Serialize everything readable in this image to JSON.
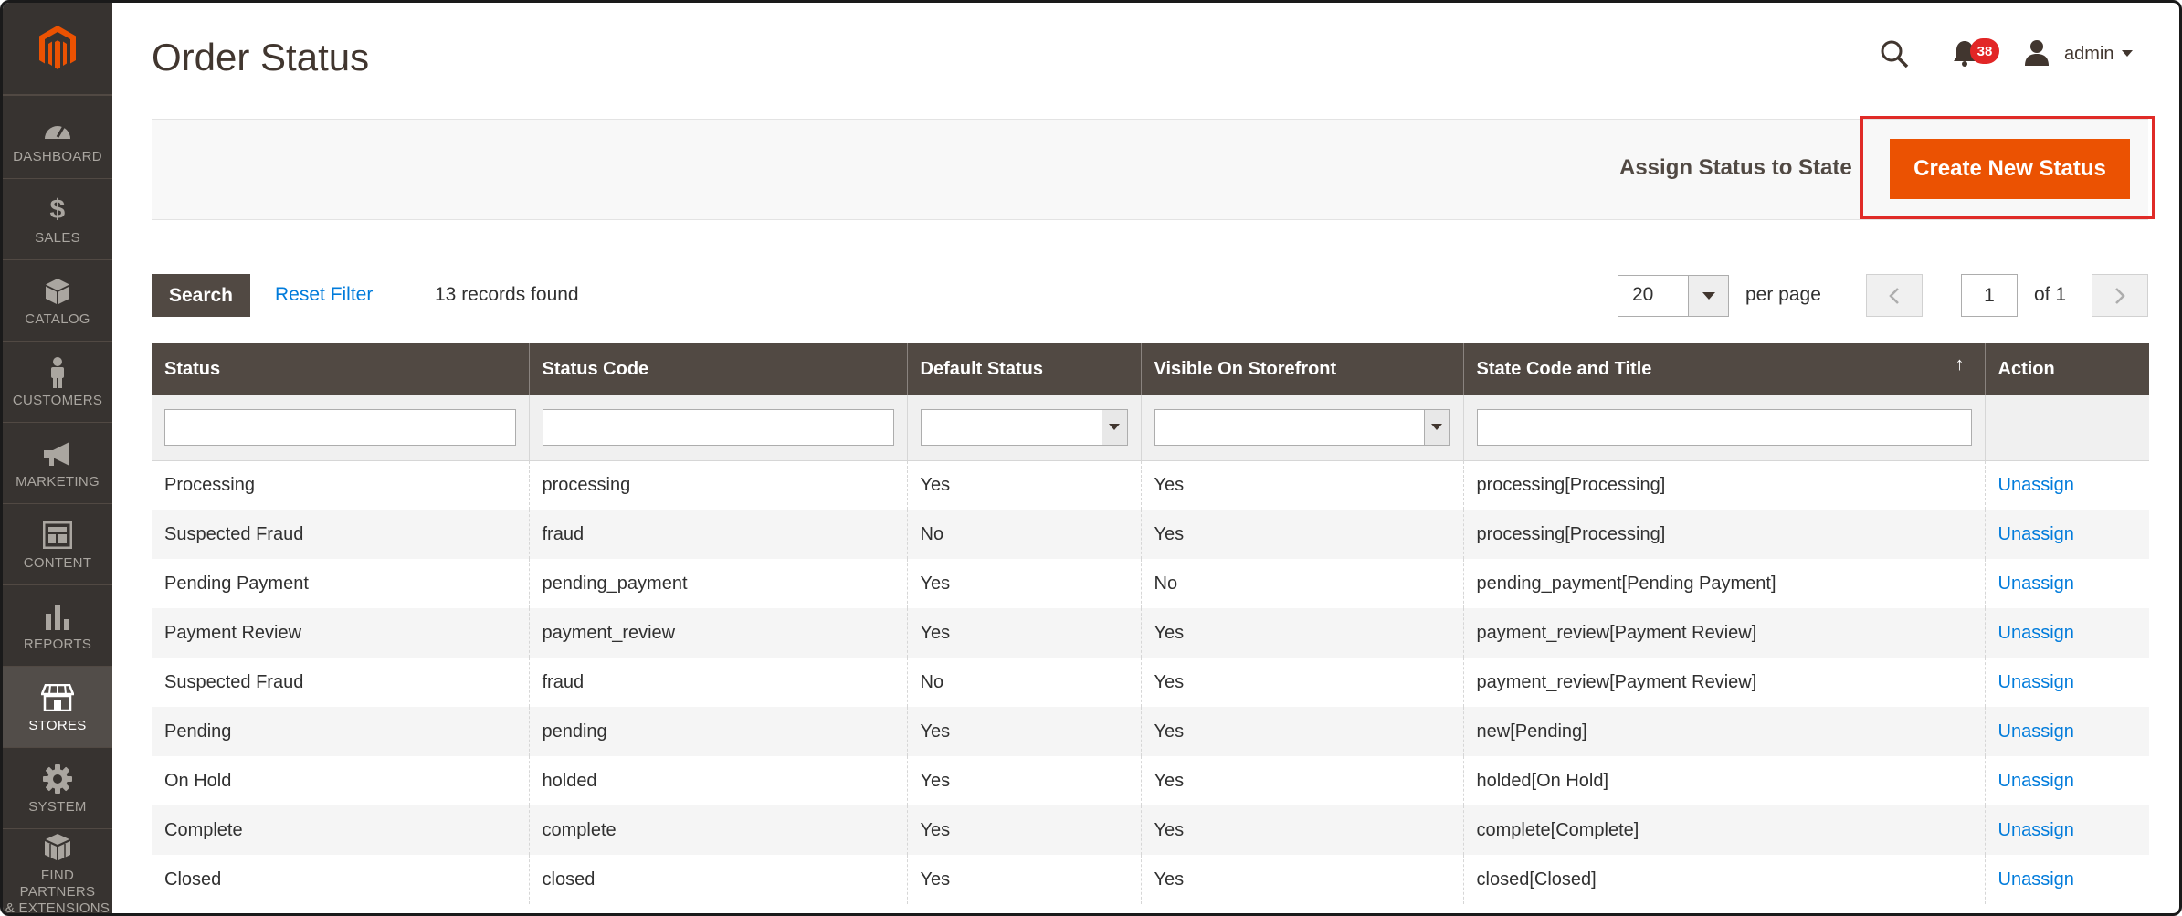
{
  "sidebar": {
    "items": [
      {
        "label": "DASHBOARD",
        "icon": "dashboard-icon"
      },
      {
        "label": "SALES",
        "icon": "dollar-icon"
      },
      {
        "label": "CATALOG",
        "icon": "cube-icon"
      },
      {
        "label": "CUSTOMERS",
        "icon": "person-icon"
      },
      {
        "label": "MARKETING",
        "icon": "megaphone-icon"
      },
      {
        "label": "CONTENT",
        "icon": "layout-icon"
      },
      {
        "label": "REPORTS",
        "icon": "bar-chart-icon"
      },
      {
        "label": "STORES",
        "icon": "store-icon"
      },
      {
        "label": "SYSTEM",
        "icon": "gear-icon"
      },
      {
        "label_line1": "FIND PARTNERS",
        "label_line2": "& EXTENSIONS",
        "icon": "boxes-icon"
      }
    ],
    "active": "STORES"
  },
  "header": {
    "title": "Order Status",
    "notifications_count": "38",
    "user": "admin"
  },
  "actions": {
    "assign_label": "Assign Status to State",
    "create_label": "Create New Status"
  },
  "grid_toolbar": {
    "search_label": "Search",
    "reset_label": "Reset Filter",
    "records_text": "13 records found",
    "per_page_value": "20",
    "per_page_label": "per page",
    "current_page": "1",
    "page_of": "of 1"
  },
  "table": {
    "columns": [
      "Status",
      "Status Code",
      "Default Status",
      "Visible On Storefront",
      "State Code and Title",
      "Action"
    ],
    "sorted_column_arrow": "↑",
    "rows": [
      [
        "Processing",
        "processing",
        "Yes",
        "Yes",
        "processing[Processing]",
        "Unassign"
      ],
      [
        "Suspected Fraud",
        "fraud",
        "No",
        "Yes",
        "processing[Processing]",
        "Unassign"
      ],
      [
        "Pending Payment",
        "pending_payment",
        "Yes",
        "No",
        "pending_payment[Pending Payment]",
        "Unassign"
      ],
      [
        "Payment Review",
        "payment_review",
        "Yes",
        "Yes",
        "payment_review[Payment Review]",
        "Unassign"
      ],
      [
        "Suspected Fraud",
        "fraud",
        "No",
        "Yes",
        "payment_review[Payment Review]",
        "Unassign"
      ],
      [
        "Pending",
        "pending",
        "Yes",
        "Yes",
        "new[Pending]",
        "Unassign"
      ],
      [
        "On Hold",
        "holded",
        "Yes",
        "Yes",
        "holded[On Hold]",
        "Unassign"
      ],
      [
        "Complete",
        "complete",
        "Yes",
        "Yes",
        "complete[Complete]",
        "Unassign"
      ],
      [
        "Closed",
        "closed",
        "Yes",
        "Yes",
        "closed[Closed]",
        "Unassign"
      ]
    ]
  },
  "colors": {
    "sidebar_bg": "#373330",
    "accent_orange": "#eb5202",
    "header_row": "#514943",
    "link_blue": "#007bdb",
    "highlight_red": "#e02b27"
  }
}
